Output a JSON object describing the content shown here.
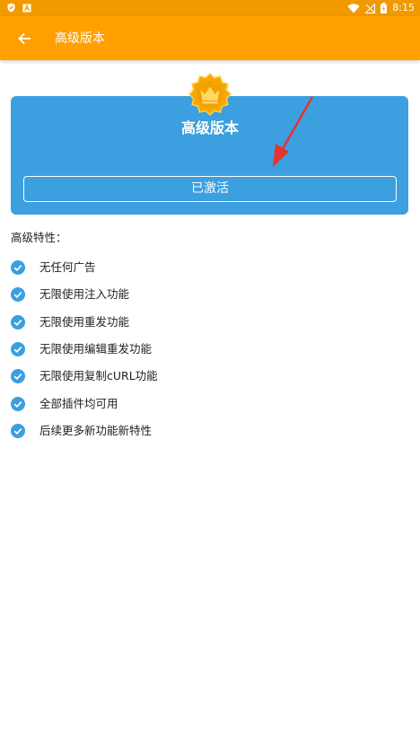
{
  "status_bar": {
    "time": "8:15",
    "icons": [
      "shield-icon",
      "a-letter-icon",
      "wifi-icon",
      "signal-off-icon",
      "battery-charging-icon"
    ]
  },
  "app_bar": {
    "back_icon": "arrow-left-icon",
    "title": "高级版本"
  },
  "card": {
    "badge_icon": "crown-badge-icon",
    "title": "高级版本",
    "button_label": "已激活"
  },
  "features": {
    "heading": "高级特性：",
    "items": [
      {
        "label": "无任何广告"
      },
      {
        "label": "无限使用注入功能"
      },
      {
        "label": "无限使用重发功能"
      },
      {
        "label": "无限使用编辑重发功能"
      },
      {
        "label": "无限使用复制cURL功能"
      },
      {
        "label": "全部插件均可用"
      },
      {
        "label": "后续更多新功能新特性"
      }
    ]
  },
  "colors": {
    "app_bar": "#ff9f00",
    "status_bar": "#f09a00",
    "card": "#3b9fe0",
    "check": "#3b9fe0",
    "annotation_arrow": "#e8322c"
  }
}
